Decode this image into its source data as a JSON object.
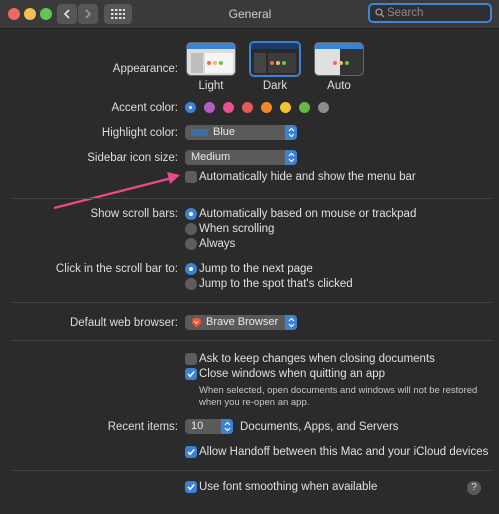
{
  "window": {
    "title": "General"
  },
  "toolbar": {
    "search_placeholder": "Search"
  },
  "appearance": {
    "label": "Appearance:",
    "options": [
      {
        "label": "Light",
        "selected": false
      },
      {
        "label": "Dark",
        "selected": true
      },
      {
        "label": "Auto",
        "selected": false
      }
    ]
  },
  "accent_color": {
    "label": "Accent color:",
    "colors": [
      "#3b82d6",
      "#b45cc4",
      "#e9508f",
      "#e85855",
      "#f0892c",
      "#f5c12e",
      "#62b945",
      "#8c8c8c"
    ]
  },
  "highlight_color": {
    "label": "Highlight color:",
    "value": "Blue",
    "swatch": "#3a6ea8"
  },
  "sidebar_icon_size": {
    "label": "Sidebar icon size:",
    "value": "Medium"
  },
  "menu_bar": {
    "label": "Automatically hide and show the menu bar",
    "checked": false
  },
  "scroll_bars": {
    "label": "Show scroll bars:",
    "options": [
      {
        "label": "Automatically based on mouse or trackpad",
        "selected": true
      },
      {
        "label": "When scrolling",
        "selected": false
      },
      {
        "label": "Always",
        "selected": false
      }
    ]
  },
  "scroll_click": {
    "label": "Click in the scroll bar to:",
    "options": [
      {
        "label": "Jump to the next page",
        "selected": true
      },
      {
        "label": "Jump to the spot that's clicked",
        "selected": false
      }
    ]
  },
  "browser": {
    "label": "Default web browser:",
    "value": "Brave Browser"
  },
  "documents": {
    "ask_keep": {
      "label": "Ask to keep changes when closing documents",
      "checked": false
    },
    "close_windows": {
      "label": "Close windows when quitting an app",
      "checked": true
    },
    "note_line1": "When selected, open documents and windows will not be restored",
    "note_line2": "when you re-open an app."
  },
  "recent_items": {
    "label": "Recent items:",
    "value": "10",
    "suffix": "Documents, Apps, and Servers"
  },
  "handoff": {
    "label": "Allow Handoff between this Mac and your iCloud devices",
    "checked": true
  },
  "font_smoothing": {
    "label": "Use font smoothing when available",
    "checked": true
  },
  "help": {
    "label": "?"
  }
}
